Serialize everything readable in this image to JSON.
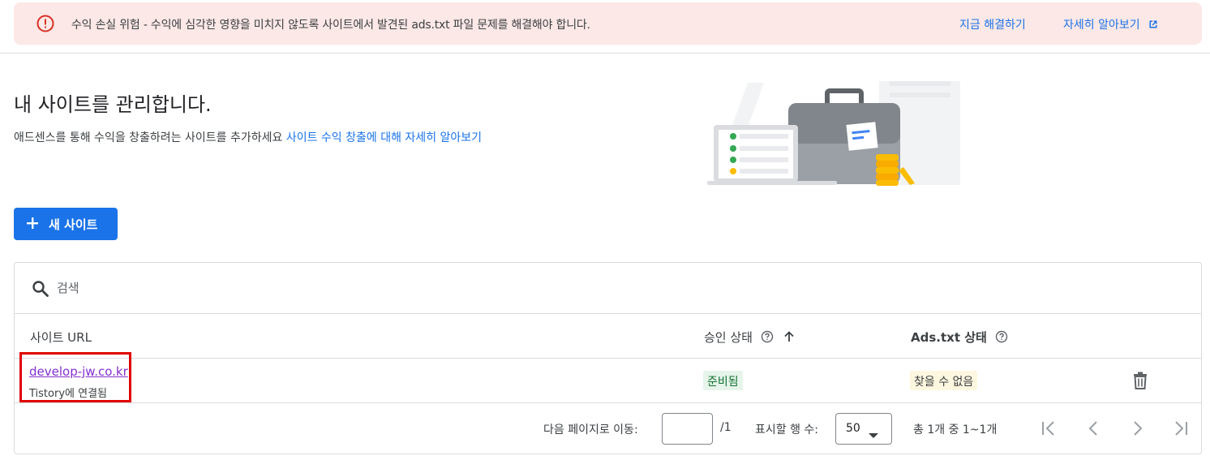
{
  "alert": {
    "message": "수익 손실 위험 - 수익에 심각한 영향을 미치지 않도록 사이트에서 발견된 ads.txt 파일 문제를 해결해야 합니다.",
    "fix_now": "지금 해결하기",
    "learn_more": "자세히 알아보기",
    "icon": "error-icon",
    "color": "#d93025",
    "background": "#fce8e6"
  },
  "header": {
    "title": "내 사이트를 관리합니다.",
    "description": "애드센스를 통해 수익을 창출하려는 사이트를 추가하세요",
    "description_link": "사이트 수익 창출에 대해 자세히 알아보기"
  },
  "new_site_button": {
    "label": "새 사이트",
    "icon": "plus-icon",
    "color": "#1a73e8"
  },
  "search": {
    "placeholder": "검색",
    "icon": "search-icon"
  },
  "table": {
    "columns": {
      "site_url": "사이트 URL",
      "approval_status": "승인 상태",
      "ads_txt_status": "Ads.txt 상태"
    },
    "rows": [
      {
        "site_url": "develop-jw.co.kr",
        "connected": "Tistory에 연결됨",
        "approval_status": "준비됨",
        "ads_txt_status": "찾을 수 없음",
        "action_icon": "trash-icon"
      }
    ]
  },
  "pagination": {
    "goto_label": "다음 페이지로 이동:",
    "page_input_value": "",
    "total_pages": "/1",
    "rows_per_page_label": "표시할 행 수:",
    "rows_per_page": "50",
    "range_text": "총 1개 중 1~1개"
  },
  "colors": {
    "link": "#1a73e8",
    "visited_link": "#8430ce",
    "ready_chip_bg": "#e6f4ea",
    "ready_chip_text": "#137333",
    "notfound_chip_bg": "#fef7e0",
    "highlight_box": "#e00000"
  }
}
